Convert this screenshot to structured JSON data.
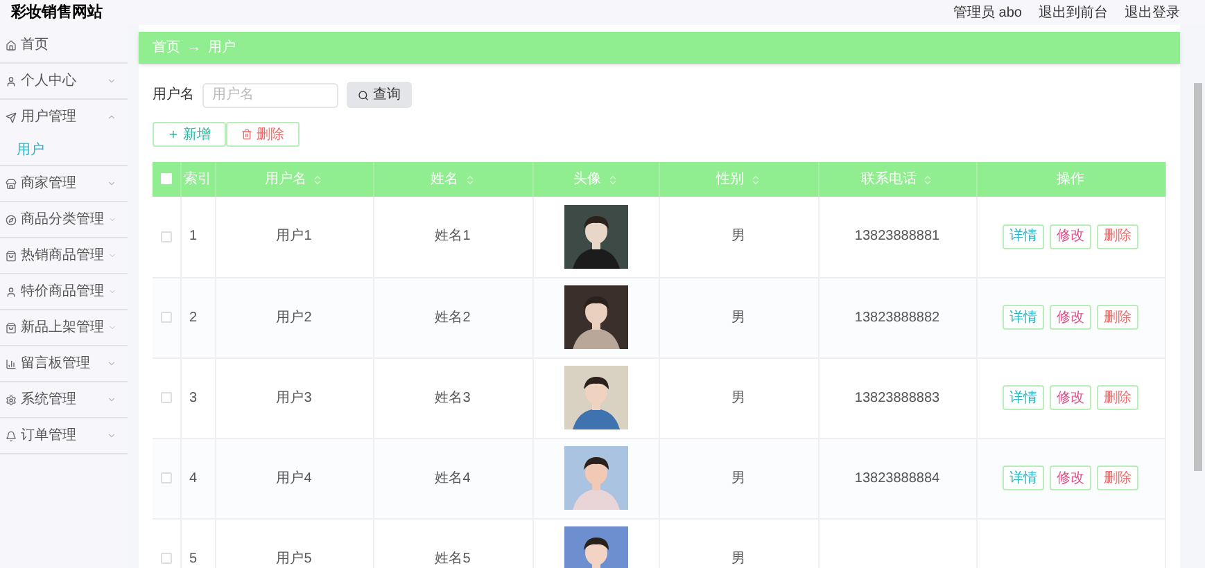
{
  "header": {
    "site_title": "彩妆销售网站",
    "links": [
      "管理员 abo",
      "退出到前台",
      "退出登录"
    ]
  },
  "sidebar": {
    "items": [
      {
        "label": "首页",
        "expandable": false
      },
      {
        "label": "个人中心",
        "expandable": true,
        "expanded": false
      },
      {
        "label": "用户管理",
        "expandable": true,
        "expanded": true,
        "children": [
          {
            "label": "用户",
            "selected": true
          }
        ]
      },
      {
        "label": "商家管理",
        "expandable": true,
        "expanded": false
      },
      {
        "label": "商品分类管理",
        "expandable": true,
        "expanded": false
      },
      {
        "label": "热销商品管理",
        "expandable": true,
        "expanded": false
      },
      {
        "label": "特价商品管理",
        "expandable": true,
        "expanded": false
      },
      {
        "label": "新品上架管理",
        "expandable": true,
        "expanded": false
      },
      {
        "label": "留言板管理",
        "expandable": true,
        "expanded": false
      },
      {
        "label": "系统管理",
        "expandable": true,
        "expanded": false
      },
      {
        "label": "订单管理",
        "expandable": true,
        "expanded": false
      }
    ]
  },
  "breadcrumb": [
    "首页",
    "→",
    "用户"
  ],
  "search": {
    "label": "用户名",
    "placeholder": "用户名",
    "button": "查询"
  },
  "actions": [
    {
      "label": "新增",
      "kind": "add"
    },
    {
      "label": "删除",
      "kind": "delete"
    }
  ],
  "table": {
    "select_all_checked": false,
    "columns": [
      {
        "label": "索引",
        "sortable": false
      },
      {
        "label": "用户名",
        "sortable": true
      },
      {
        "label": "姓名",
        "sortable": true
      },
      {
        "label": "头像",
        "sortable": true
      },
      {
        "label": "性别",
        "sortable": true
      },
      {
        "label": "联系电话",
        "sortable": true
      },
      {
        "label": "操作",
        "sortable": false
      }
    ],
    "rows": [
      {
        "checked": false,
        "index": "1",
        "username": "用户1",
        "name": "姓名1",
        "sex": "男",
        "phone": "13823888881",
        "buttons": [
          {
            "label": "详情",
            "kind": "detail"
          },
          {
            "label": "修改",
            "kind": "edit"
          },
          {
            "label": "删除",
            "kind": "delete"
          }
        ]
      },
      {
        "checked": false,
        "index": "2",
        "username": "用户2",
        "name": "姓名2",
        "sex": "男",
        "phone": "13823888882",
        "buttons": [
          {
            "label": "详情",
            "kind": "detail"
          },
          {
            "label": "修改",
            "kind": "edit"
          },
          {
            "label": "删除",
            "kind": "delete"
          }
        ]
      },
      {
        "checked": false,
        "index": "3",
        "username": "用户3",
        "name": "姓名3",
        "sex": "男",
        "phone": "13823888883",
        "buttons": [
          {
            "label": "详情",
            "kind": "detail"
          },
          {
            "label": "修改",
            "kind": "edit"
          },
          {
            "label": "删除",
            "kind": "delete"
          }
        ]
      },
      {
        "checked": false,
        "index": "4",
        "username": "用户4",
        "name": "姓名4",
        "sex": "男",
        "phone": "13823888884",
        "buttons": [
          {
            "label": "详情",
            "kind": "detail"
          },
          {
            "label": "修改",
            "kind": "edit"
          },
          {
            "label": "删除",
            "kind": "delete"
          }
        ]
      },
      {
        "checked": false,
        "index": "5",
        "username": "用户5",
        "name": "姓名5",
        "sex": "男"
      }
    ]
  }
}
